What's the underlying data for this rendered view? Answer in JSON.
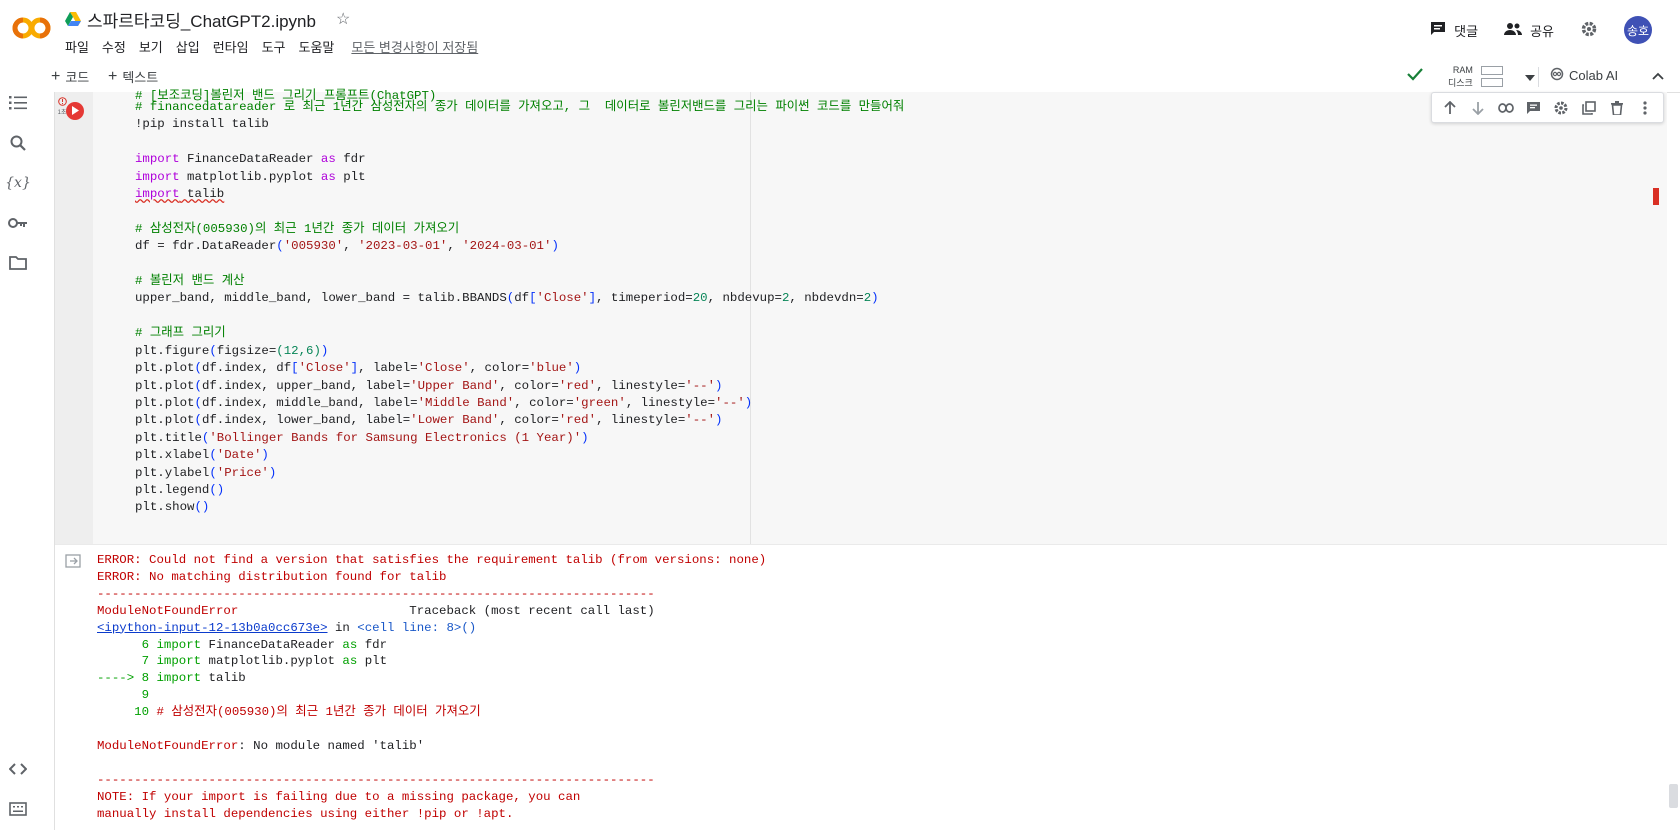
{
  "header": {
    "notebook_title": "스파르타코딩_ChatGPT2.ipynb",
    "menu": [
      "파일",
      "수정",
      "보기",
      "삽입",
      "런타임",
      "도구",
      "도움말"
    ],
    "saved_status": "모든 변경사항이 저장됨",
    "comment_label": "댓글",
    "share_label": "공유",
    "avatar_text": "송호"
  },
  "toolbar": {
    "add_code": "코드",
    "add_text": "텍스트",
    "ram_label": "RAM",
    "disk_label": "디스크",
    "colab_ai": "Colab AI"
  },
  "cell": {
    "exec_time": "1초",
    "cut_first_line": "# [보조코딩]볼린저 밴드 그리기 프롬프트(ChatGPT)",
    "comment1": "# financedatareader 로 최근 1년간 삼성전자의 종가 데이터를 가져오고, 그  데이터로 볼린저밴드를 그리는 파이썬 코드를 만들어줘",
    "lines": {
      "pip": "!pip install talib",
      "kw_import": "import",
      "kw_as": "as",
      "imp1_mod": " FinanceDataReader ",
      "imp1_alias": " fdr",
      "imp2_mod": " matplotlib.pyplot ",
      "imp2_alias": " plt",
      "imp3_mod": " talib",
      "comment2": "# 삼성전자(005930)의 최근 1년간 종가 데이터 가져오기",
      "df_a": "df = fdr.DataReader",
      "df_s1": "'005930'",
      "df_s2": "'2023-03-01'",
      "df_s3": "'2024-03-01'",
      "comment3": "# 볼린저 밴드 계산",
      "bb_a": "upper_band, middle_band, lower_band = talib.BBANDS",
      "bb_b": "df",
      "bb_s": "'Close'",
      "bb_c": ", timeperiod=",
      "bb_n1": "20",
      "bb_d": ", nbdevup=",
      "bb_n2": "2",
      "bb_e": ", nbdevdn=",
      "bb_n3": "2",
      "comment4": "# 그래프 그리기",
      "fig_a": "plt.figure",
      "fig_b": "figsize=",
      "fig_n": "(12,6)",
      "p1_a": "plt.plot",
      "p1_b": "df.index, df",
      "p1_s1": "'Close'",
      "p1_c": ", label=",
      "p1_s2": "'Close'",
      "p1_d": ", color=",
      "p1_s3": "'blue'",
      "p2_b": "df.index, upper_band, label=",
      "p2_s1": "'Upper Band'",
      "p2_s2": "'red'",
      "p2_e": ", linestyle=",
      "p2_s3": "'--'",
      "p3_b": "df.index, middle_band, label=",
      "p3_s1": "'Middle Band'",
      "p3_s2": "'green'",
      "p4_b": "df.index, lower_band, label=",
      "p4_s1": "'Lower Band'",
      "p4_s2": "'red'",
      "title_a": "plt.title",
      "title_s": "'Bollinger Bands for Samsung Electronics (1 Year)'",
      "xl_a": "plt.xlabel",
      "xl_s": "'Date'",
      "yl_a": "plt.ylabel",
      "yl_s": "'Price'",
      "legend": "plt.legend",
      "show": "plt.show"
    }
  },
  "output": {
    "err1": "ERROR: Could not find a version that satisfies the requirement talib (from versions: none)",
    "err2": "ERROR: No matching distribution found for talib",
    "dashes": "---------------------------------------------------------------------------",
    "exc_name": "ModuleNotFoundError",
    "traceback_hdr": "                       Traceback (most recent call last)",
    "input_link": "<ipython-input-12-13b0a0cc673e>",
    "in_word": " in ",
    "cell_line": "<cell line: 8>",
    "cell_line_paren": "()",
    "tb_num6": "      6 ",
    "tb_num7": "      7 ",
    "tb_arrow": "----> 8 ",
    "tb_num9": "      9",
    "tb_num10": "     10 ",
    "tb_import": "import",
    "tb_l6": " FinanceDataReader ",
    "tb_as": "as",
    "tb_l6b": " fdr",
    "tb_l7": " matplotlib.pyplot ",
    "tb_l7b": " plt",
    "tb_l8": " talib",
    "tb_l10": "# 삼성전자(005930)의 최근 1년간 종가 데이터 가져오기",
    "final_err_name": "ModuleNotFoundError",
    "final_err_msg": ": No module named 'talib'",
    "note1": "NOTE: If your import is failing due to a missing package, you can",
    "note2": "manually install dependencies using either !pip or !apt."
  }
}
